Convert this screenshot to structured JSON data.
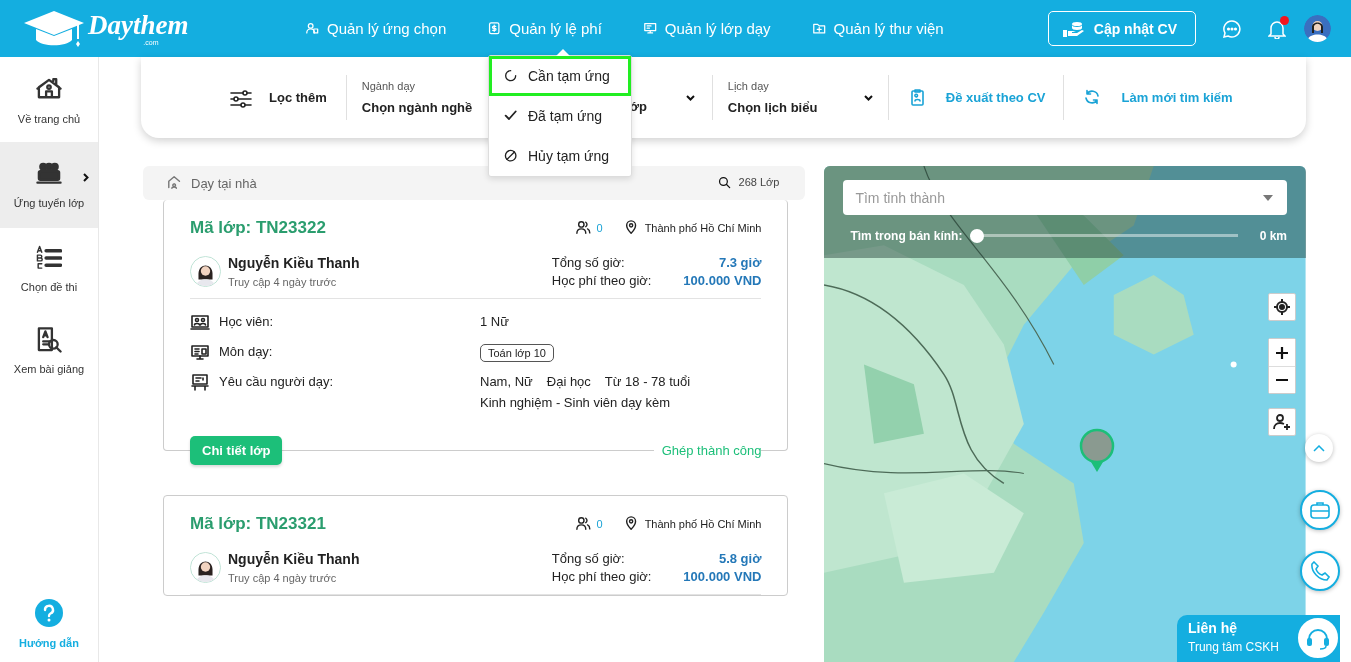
{
  "header": {
    "logo": {
      "name": "Daythem",
      "suffix": ".com"
    },
    "nav": [
      {
        "label": "Quản lý ứng chọn"
      },
      {
        "label": "Quản lý lệ phí"
      },
      {
        "label": "Quản lý lớp dạy"
      },
      {
        "label": "Quản lý thư viện"
      }
    ],
    "cv_button": "Cập nhật CV",
    "unread_notifications": true
  },
  "fee_menu": {
    "items": [
      {
        "label": "Cần tạm ứng",
        "selected": true
      },
      {
        "label": "Đã tạm ứng",
        "selected": false
      },
      {
        "label": "Hủy tạm ứng",
        "selected": false
      }
    ]
  },
  "sidebar": {
    "items": [
      {
        "label": "Về trang chủ",
        "selected": false
      },
      {
        "label": "Ứng tuyển lớp",
        "selected": true
      },
      {
        "label": "Chọn đề thi",
        "selected": false
      },
      {
        "label": "Xem bài giảng",
        "selected": false
      }
    ],
    "help": "Hướng dẫn"
  },
  "filter_bar": {
    "more_filters": "Lọc thêm",
    "selects": [
      {
        "label": "Ngành dạy",
        "value": "Chọn ngành nghề",
        "chevron": false
      },
      {
        "value": "ớp",
        "chevron": true
      },
      {
        "label": "Lịch dạy",
        "value": "Chọn lịch biểu",
        "chevron": true
      }
    ],
    "actions": [
      {
        "label": "Đề xuất theo CV"
      },
      {
        "label": "Làm mới tìm kiếm"
      }
    ]
  },
  "list": {
    "category": "Dạy tại nhà",
    "count": "268 Lớp",
    "classes": [
      {
        "code": "Mã lớp: TN23322",
        "applicants": "0",
        "location": "Thành phố Hồ Chí Minh",
        "student_name": "Nguyễn Kiều Thanh",
        "last_seen": "Truy cập 4 ngày trước",
        "hours_label": "Tổng số giờ:",
        "hours": "7.3 giờ",
        "fee_label": "Học phí theo giờ:",
        "fee": "100.000 VND",
        "details": [
          {
            "kind": "text",
            "label": "Học viên:",
            "values": [
              "1 Nữ"
            ]
          },
          {
            "kind": "tag",
            "label": "Môn dạy:",
            "values": [
              "Toán lớp 10"
            ]
          },
          {
            "kind": "text",
            "label": "Yêu cầu người dạy:",
            "values": [
              "Nam, Nữ",
              "Đại học",
              "Từ 18 - 78 tuổi"
            ],
            "extra": "Kinh nghiệm - Sinh viên dạy kèm"
          }
        ],
        "detail_button": "Chi tiết lớp",
        "status": "Ghép thành công"
      },
      {
        "code": "Mã lớp: TN23321",
        "applicants": "0",
        "location": "Thành phố Hồ Chí Minh",
        "student_name": "Nguyễn Kiều Thanh",
        "last_seen": "Truy cập 4 ngày trước",
        "hours_label": "Tổng số giờ:",
        "hours": "5.8 giờ",
        "fee_label": "Học phí theo giờ:",
        "fee": "100.000 VND"
      }
    ]
  },
  "map": {
    "kind": "picture",
    "search_placeholder": "Tìm tỉnh thành",
    "radius_label": "Tìm trong bán kính:",
    "radius": {
      "level": 0
    },
    "radius_reading": "0 km"
  },
  "contact": {
    "title": "Liên hệ",
    "subtitle": "Trung tâm CSKH"
  }
}
